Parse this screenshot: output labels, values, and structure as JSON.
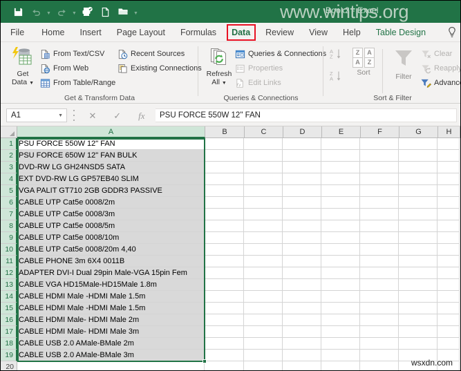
{
  "window": {
    "title": "Book2 - Excel",
    "watermark_top": "www.wintips.org",
    "watermark_bottom": "wsxdn.com"
  },
  "quick_access": [
    {
      "name": "save-icon",
      "label": "Save",
      "enabled": true
    },
    {
      "name": "undo-icon",
      "label": "Undo",
      "enabled": false
    },
    {
      "name": "redo-icon",
      "label": "Redo",
      "enabled": false
    },
    {
      "name": "print-preview-icon",
      "label": "Print Preview and Print",
      "enabled": true
    },
    {
      "name": "new-file-icon",
      "label": "New",
      "enabled": true
    },
    {
      "name": "open-folder-icon",
      "label": "Open",
      "enabled": true
    },
    {
      "name": "customize-qat-icon",
      "label": "Customize Quick Access Toolbar",
      "enabled": true
    }
  ],
  "tabs": [
    {
      "label": "File",
      "active": false
    },
    {
      "label": "Home",
      "active": false
    },
    {
      "label": "Insert",
      "active": false
    },
    {
      "label": "Page Layout",
      "active": false
    },
    {
      "label": "Formulas",
      "active": false
    },
    {
      "label": "Data",
      "active": true
    },
    {
      "label": "Review",
      "active": false
    },
    {
      "label": "View",
      "active": false
    },
    {
      "label": "Help",
      "active": false
    },
    {
      "label": "Table Design",
      "active": false
    }
  ],
  "tell_me": {
    "icon": "lightbulb-icon",
    "label": "Tell me what you want to do"
  },
  "ribbon": {
    "groups": [
      {
        "name": "get-transform-data",
        "label": "Get & Transform Data",
        "big_button": {
          "label_line1": "Get",
          "label_line2": "Data",
          "icon": "get-data-icon",
          "has_dropdown": true
        },
        "items": [
          {
            "label": "From Text/CSV",
            "icon": "from-text-csv-icon",
            "enabled": true
          },
          {
            "label": "From Web",
            "icon": "from-web-icon",
            "enabled": true
          },
          {
            "label": "From Table/Range",
            "icon": "from-table-range-icon",
            "enabled": true
          },
          {
            "label": "Recent Sources",
            "icon": "recent-sources-icon",
            "enabled": true
          },
          {
            "label": "Existing Connections",
            "icon": "existing-connections-icon",
            "enabled": true
          }
        ]
      },
      {
        "name": "queries-connections",
        "label": "Queries & Connections",
        "big_button": {
          "label_line1": "Refresh",
          "label_line2": "All",
          "icon": "refresh-all-icon",
          "has_dropdown": true
        },
        "items": [
          {
            "label": "Queries & Connections",
            "icon": "queries-connections-icon",
            "enabled": true
          },
          {
            "label": "Properties",
            "icon": "properties-icon",
            "enabled": false
          },
          {
            "label": "Edit Links",
            "icon": "edit-links-icon",
            "enabled": false
          }
        ]
      },
      {
        "name": "sort-filter",
        "label": "Sort & Filter",
        "buttons": [
          {
            "label": "",
            "icon": "sort-ascending-icon",
            "enabled": false
          },
          {
            "label": "",
            "icon": "sort-descending-icon",
            "enabled": false
          },
          {
            "label": "Sort",
            "icon": "sort-icon",
            "enabled": false
          },
          {
            "label": "Filter",
            "icon": "filter-icon",
            "enabled": false
          }
        ],
        "items": [
          {
            "label": "Clear",
            "icon": "clear-filter-icon",
            "enabled": false
          },
          {
            "label": "Reapply",
            "icon": "reapply-filter-icon",
            "enabled": false
          },
          {
            "label": "Advanced",
            "icon": "advanced-filter-icon",
            "enabled": true
          }
        ]
      }
    ]
  },
  "formula_bar": {
    "name_box": "A1",
    "cancel_icon": "cancel-icon",
    "enter_icon": "confirm-icon",
    "function_icon": "insert-function-icon",
    "value": "PSU FORCE 550W 12\" FAN"
  },
  "grid": {
    "columns": [
      "A",
      "B",
      "C",
      "D",
      "E",
      "F",
      "G",
      "H"
    ],
    "selected_column": "A",
    "selection_range": "A1:A19",
    "rows": [
      {
        "n": "1",
        "a": "PSU FORCE 550W 12\" FAN"
      },
      {
        "n": "2",
        "a": "PSU FORCE 650W 12\" FAN BULK"
      },
      {
        "n": "3",
        "a": "DVD-RW LG GH24NSD5 SATA"
      },
      {
        "n": "4",
        "a": "EXT DVD-RW LG GP57EB40 SLIM"
      },
      {
        "n": "5",
        "a": "VGA PALIT GT710 2GB GDDR3 PASSIVE"
      },
      {
        "n": "6",
        "a": "CABLE UTP Cat5e 0008/2m"
      },
      {
        "n": "7",
        "a": "CABLE UTP Cat5e 0008/3m"
      },
      {
        "n": "8",
        "a": "CABLE UTP Cat5e 0008/5m"
      },
      {
        "n": "9",
        "a": "CABLE UTP Cat5e 0008/10m"
      },
      {
        "n": "10",
        "a": "CABLE UTP Cat5e 0008/20m 4,40"
      },
      {
        "n": "11",
        "a": "CABLE PHONE 3m 6X4 0011B"
      },
      {
        "n": "12",
        "a": "ADAPTER DVI-I Dual 29pin Male-VGA 15pin Fem"
      },
      {
        "n": "13",
        "a": "CABLE VGA HD15Male-HD15Male 1.8m"
      },
      {
        "n": "14",
        "a": "CABLE HDMI Male -HDMI Male 1.5m"
      },
      {
        "n": "15",
        "a": "CABLE HDMI Male -HDMI Male 1.5m"
      },
      {
        "n": "16",
        "a": "CABLE HDMI Male- HDMI Male 2m"
      },
      {
        "n": "17",
        "a": "CABLE HDMI Male- HDMI Male 3m"
      },
      {
        "n": "18",
        "a": "CABLE USB 2.0 AMale-BMale 2m"
      },
      {
        "n": "19",
        "a": "CABLE USB 2.0 AMale-BMale 3m"
      },
      {
        "n": "20",
        "a": ""
      }
    ]
  },
  "annotations": {
    "red_box_target": "Data",
    "red_arrow_target": "From Table/Range",
    "color": "#e81123"
  }
}
